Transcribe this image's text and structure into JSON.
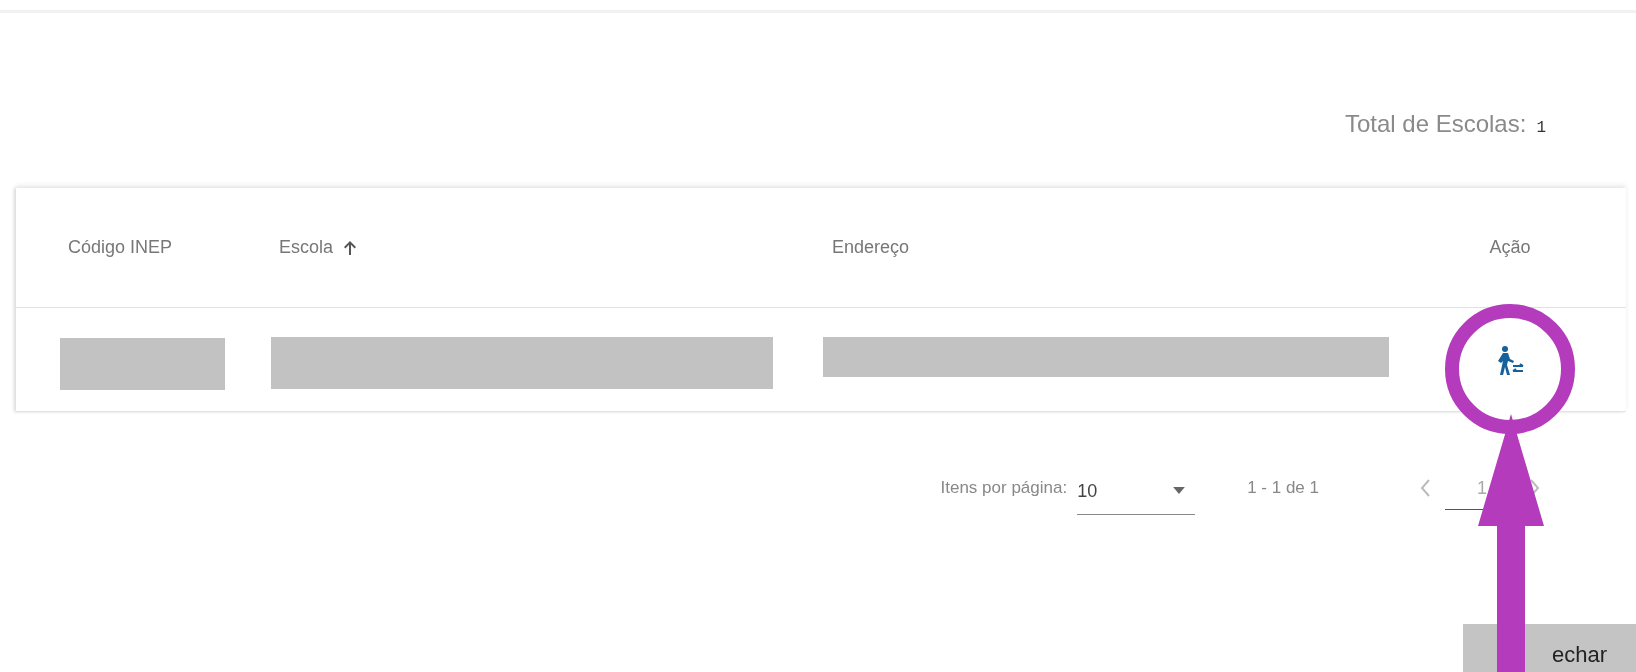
{
  "summary": {
    "label": "Total de Escolas:",
    "value": "1"
  },
  "table": {
    "columns": [
      {
        "label": "Código INEP",
        "sorted": false
      },
      {
        "label": "Escola",
        "sorted": true
      },
      {
        "label": "Endereço",
        "sorted": false
      },
      {
        "label": "Ação",
        "sorted": false
      }
    ]
  },
  "paginator": {
    "page_size_label": "Itens por página:",
    "page_size": "10",
    "range": "1 - 1 de 1",
    "page": "1"
  },
  "close_button": {
    "label": "echar"
  }
}
